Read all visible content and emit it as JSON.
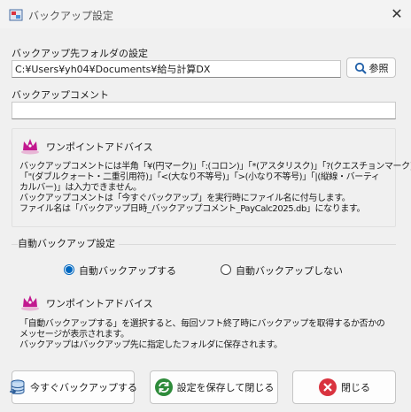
{
  "window": {
    "title": "バックアップ設定",
    "close_glyph": "✕"
  },
  "folder": {
    "label": "バックアップ先フォルダの設定",
    "path": "C:¥Users¥yh04¥Documents¥給与計算DX",
    "browse_label": "参照"
  },
  "comment": {
    "label": "バックアップコメント",
    "value": ""
  },
  "tip1": {
    "heading": "ワンポイントアドバイス",
    "lines": [
      "バックアップコメントには半角「¥(円マーク)」「:(コロン)」「*(アスタリスク)」「?(クエスチョンマーク)」",
      "「\"(ダブルクォート・二重引用符)」「<(大なり不等号)」「>(小なり不等号)」「|(縦線・バーティ",
      "カルバー)」は入力できません。",
      "バックアップコメントは「今すぐバックアップ」を実行時にファイル名に付与します。",
      "ファイル名は「バックアップ日時_バックアップコメント_PayCalc2025.db」になります。"
    ]
  },
  "auto": {
    "group_label": "自動バックアップ設定",
    "option_on": "自動バックアップする",
    "option_off": "自動バックアップしない",
    "selected": "on"
  },
  "tip2": {
    "heading": "ワンポイントアドバイス",
    "lines": [
      "「自動バックアップする」を選択すると、毎回ソフト終了時にバックアップを取得するか否かの",
      "メッセージが表示されます。",
      "バックアップはバックアップ先に指定したフォルダに保存されます。"
    ]
  },
  "buttons": {
    "backup_now": "今すぐバックアップする",
    "save_close": "設定を保存して閉じる",
    "close": "閉じる"
  },
  "colors": {
    "accent": "#0067c0",
    "tip_icon": "#c2188f",
    "save_icon": "#2e8b3a",
    "close_icon": "#d9333f"
  }
}
